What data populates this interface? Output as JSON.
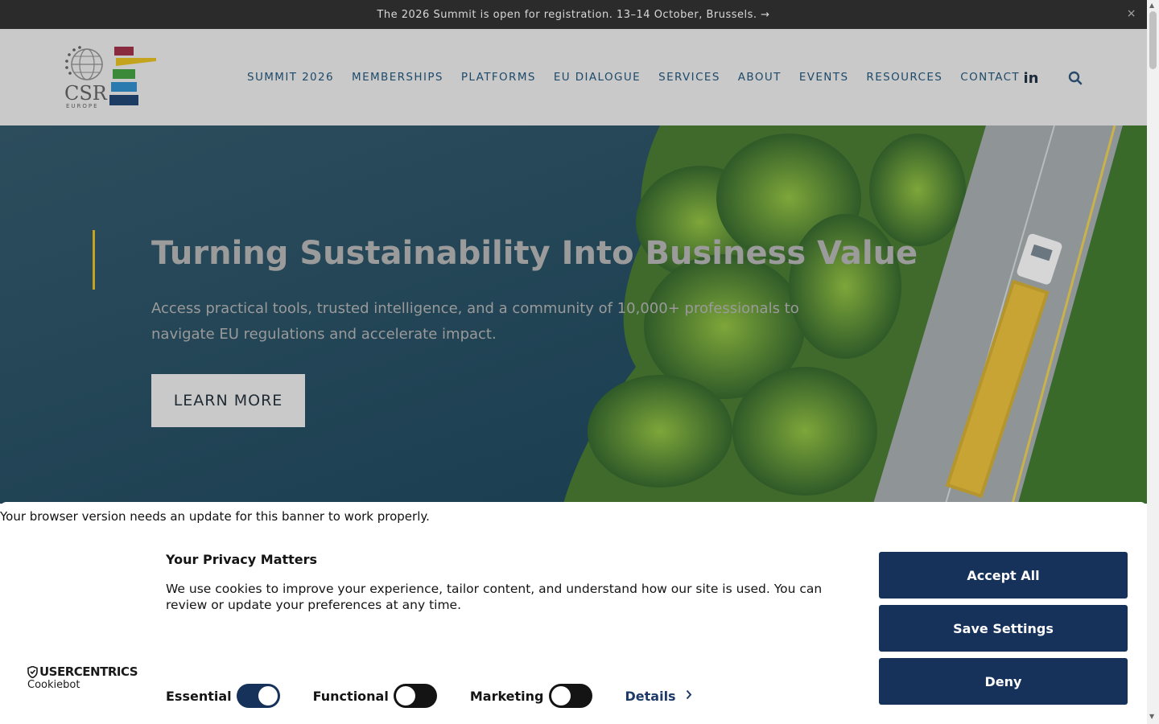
{
  "announcement": {
    "text": "The 2026 Summit is open for registration. 13–14 October, Brussels. →",
    "close_glyph": "×"
  },
  "header": {
    "logo_text": "CSR",
    "logo_subtext": "EUROPE",
    "nav": [
      {
        "label": "SUMMIT 2026"
      },
      {
        "label": "MEMBERSHIPS"
      },
      {
        "label": "PLATFORMS"
      },
      {
        "label": "EU DIALOGUE"
      },
      {
        "label": "SERVICES"
      },
      {
        "label": "ABOUT"
      },
      {
        "label": "EVENTS"
      },
      {
        "label": "RESOURCES"
      },
      {
        "label": "CONTACT"
      }
    ],
    "linkedin_label": "in",
    "icons": [
      "linkedin-icon",
      "search-icon"
    ]
  },
  "hero": {
    "title": "Turning Sustainability Into Business Value",
    "subtitle": "Access practical tools, trusted intelligence, and a community of 10,000+ professionals to navigate EU regulations and accelerate impact.",
    "cta_label": "LEARN MORE"
  },
  "cookie_banner": {
    "browser_warning": "Your browser version needs an update for this banner to work properly.",
    "title": "Your Privacy Matters",
    "text": "We use cookies to improve your experience, tailor content, and understand how our site is used. You can review or update your preferences at any time.",
    "brand": "USERCENTRICS",
    "brand_sub": "Cookiebot",
    "toggles": [
      {
        "label": "Essential",
        "state": "on"
      },
      {
        "label": "Functional",
        "state": "off"
      },
      {
        "label": "Marketing",
        "state": "off"
      }
    ],
    "details_label": "Details",
    "buttons": {
      "accept": "Accept All",
      "save": "Save Settings",
      "deny": "Deny"
    }
  },
  "colors": {
    "primary_button": "#16315a",
    "nav_text": "#1e4a6a",
    "accent": "#c4a41e"
  }
}
